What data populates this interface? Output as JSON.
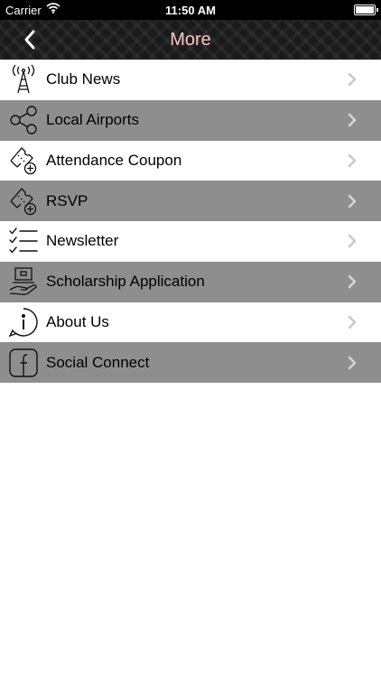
{
  "status_bar": {
    "carrier": "Carrier",
    "time": "11:50 AM"
  },
  "nav_bar": {
    "title": "More"
  },
  "menu": {
    "items": [
      {
        "label": "Club News",
        "icon": "radio-tower-icon",
        "shade": "light"
      },
      {
        "label": "Local Airports",
        "icon": "share-icon",
        "shade": "dark"
      },
      {
        "label": "Attendance Coupon",
        "icon": "ticket-add-icon",
        "shade": "light"
      },
      {
        "label": "RSVP",
        "icon": "ticket-add-icon",
        "shade": "dark"
      },
      {
        "label": "Newsletter",
        "icon": "checklist-icon",
        "shade": "light"
      },
      {
        "label": "Scholarship Application",
        "icon": "laptop-hand-icon",
        "shade": "dark"
      },
      {
        "label": "About Us",
        "icon": "info-icon",
        "shade": "light"
      },
      {
        "label": "Social Connect",
        "icon": "facebook-icon",
        "shade": "dark"
      }
    ]
  },
  "colors": {
    "title": "#ffc4c4",
    "row_dark": "#8e8e8e",
    "row_light": "#ffffff"
  }
}
